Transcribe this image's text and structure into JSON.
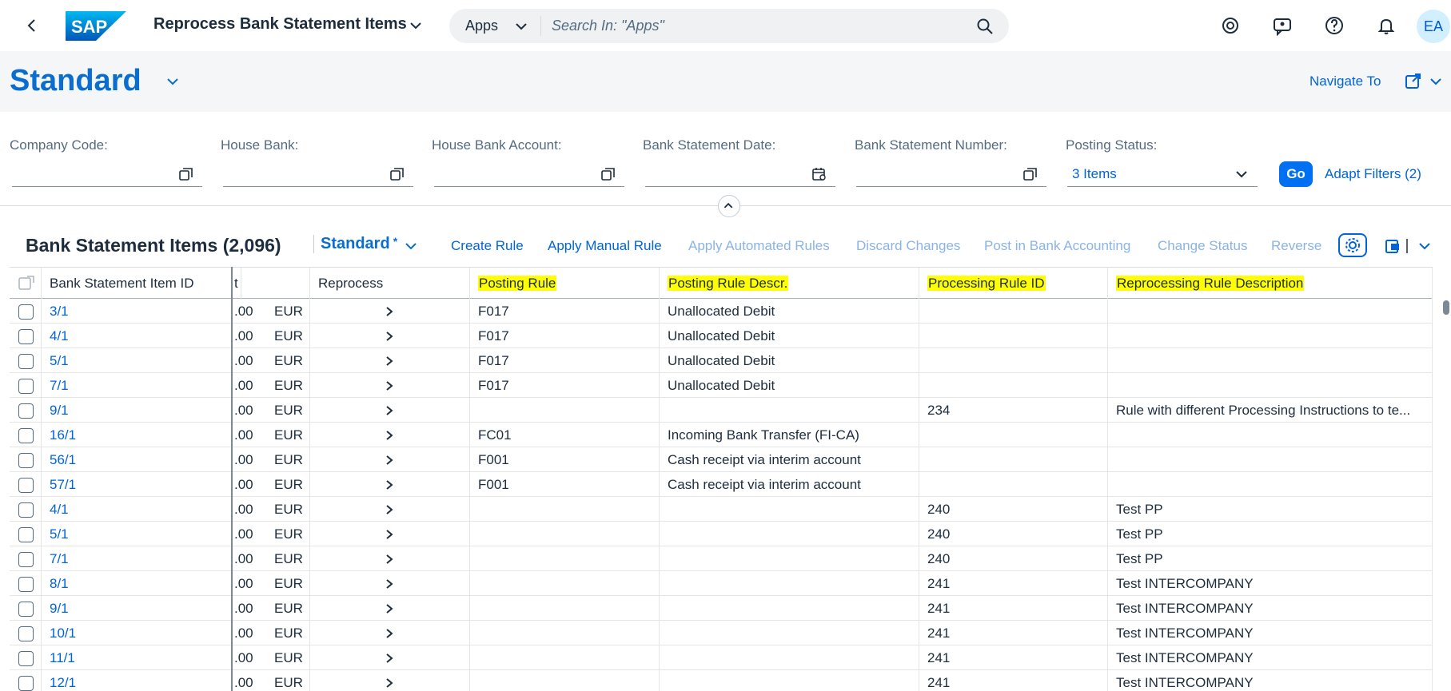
{
  "shell": {
    "back_icon": "chevron-left-icon",
    "logo_text": "SAP",
    "app_title": "Reprocess Bank Statement Items",
    "search_scope": "Apps",
    "search_placeholder": "Search In: \"Apps\"",
    "avatar_initials": "EA",
    "icons": [
      "copilot-icon",
      "feedback-icon",
      "help-icon",
      "notification-bell-icon"
    ]
  },
  "header": {
    "variant": "Standard",
    "navigate_to": "Navigate To"
  },
  "filters": {
    "fields": [
      {
        "label": "Company Code:",
        "value": ""
      },
      {
        "label": "House Bank:",
        "value": ""
      },
      {
        "label": "House Bank Account:",
        "value": ""
      },
      {
        "label": "Bank Statement Date:",
        "value": ""
      },
      {
        "label": "Bank Statement Number:",
        "value": ""
      },
      {
        "label": "Posting Status:",
        "value": "3 Items"
      }
    ],
    "go_label": "Go",
    "adapt_label": "Adapt Filters (2)"
  },
  "toolbar": {
    "title": "Bank Statement Items (2,096)",
    "variant": "Standard",
    "variant_modified": "*",
    "buttons": [
      {
        "label": "Create Rule",
        "enabled": true
      },
      {
        "label": "Apply Manual Rule",
        "enabled": true
      },
      {
        "label": "Apply Automated Rules",
        "enabled": false
      },
      {
        "label": "Discard Changes",
        "enabled": false
      },
      {
        "label": "Post in Bank Accounting",
        "enabled": false
      },
      {
        "label": "Change Status",
        "enabled": false
      },
      {
        "label": "Reverse",
        "enabled": false
      }
    ]
  },
  "table": {
    "columns": {
      "item_id": "Bank Statement Item ID",
      "amount": "t",
      "reprocess": "Reprocess",
      "posting_rule": "Posting Rule",
      "posting_rule_descr": "Posting Rule Descr.",
      "processing_rule_id": "Processing Rule ID",
      "reprocessing_rule_descr": "Reprocessing Rule Description"
    },
    "highlight_color": "#ffff00",
    "rows": [
      {
        "id": "3/1",
        "amt": ".00",
        "cur": "EUR",
        "rule": "F017",
        "rule_descr": "Unallocated Debit",
        "proc_id": "",
        "reproc_descr": ""
      },
      {
        "id": "4/1",
        "amt": ".00",
        "cur": "EUR",
        "rule": "F017",
        "rule_descr": "Unallocated Debit",
        "proc_id": "",
        "reproc_descr": ""
      },
      {
        "id": "5/1",
        "amt": ".00",
        "cur": "EUR",
        "rule": "F017",
        "rule_descr": "Unallocated Debit",
        "proc_id": "",
        "reproc_descr": ""
      },
      {
        "id": "7/1",
        "amt": ".00",
        "cur": "EUR",
        "rule": "F017",
        "rule_descr": "Unallocated Debit",
        "proc_id": "",
        "reproc_descr": ""
      },
      {
        "id": "9/1",
        "amt": ".00",
        "cur": "EUR",
        "rule": "",
        "rule_descr": "",
        "proc_id": "234",
        "reproc_descr": "Rule with different Processing Instructions to te..."
      },
      {
        "id": "16/1",
        "amt": ".00",
        "cur": "EUR",
        "rule": "FC01",
        "rule_descr": "Incoming Bank Transfer (FI-CA)",
        "proc_id": "",
        "reproc_descr": ""
      },
      {
        "id": "56/1",
        "amt": ".00",
        "cur": "EUR",
        "rule": "F001",
        "rule_descr": "Cash receipt via interim account",
        "proc_id": "",
        "reproc_descr": ""
      },
      {
        "id": "57/1",
        "amt": ".00",
        "cur": "EUR",
        "rule": "F001",
        "rule_descr": "Cash receipt via interim account",
        "proc_id": "",
        "reproc_descr": ""
      },
      {
        "id": "4/1",
        "amt": ".00",
        "cur": "EUR",
        "rule": "",
        "rule_descr": "",
        "proc_id": "240",
        "reproc_descr": "Test PP"
      },
      {
        "id": "5/1",
        "amt": ".00",
        "cur": "EUR",
        "rule": "",
        "rule_descr": "",
        "proc_id": "240",
        "reproc_descr": "Test PP"
      },
      {
        "id": "7/1",
        "amt": ".00",
        "cur": "EUR",
        "rule": "",
        "rule_descr": "",
        "proc_id": "240",
        "reproc_descr": "Test PP"
      },
      {
        "id": "8/1",
        "amt": ".00",
        "cur": "EUR",
        "rule": "",
        "rule_descr": "",
        "proc_id": "241",
        "reproc_descr": "Test INTERCOMPANY"
      },
      {
        "id": "9/1",
        "amt": ".00",
        "cur": "EUR",
        "rule": "",
        "rule_descr": "",
        "proc_id": "241",
        "reproc_descr": "Test INTERCOMPANY"
      },
      {
        "id": "10/1",
        "amt": ".00",
        "cur": "EUR",
        "rule": "",
        "rule_descr": "",
        "proc_id": "241",
        "reproc_descr": "Test INTERCOMPANY"
      },
      {
        "id": "11/1",
        "amt": ".00",
        "cur": "EUR",
        "rule": "",
        "rule_descr": "",
        "proc_id": "241",
        "reproc_descr": "Test INTERCOMPANY"
      },
      {
        "id": "12/1",
        "amt": ".00",
        "cur": "EUR",
        "rule": "",
        "rule_descr": "",
        "proc_id": "241",
        "reproc_descr": "Test INTERCOMPANY"
      }
    ]
  }
}
